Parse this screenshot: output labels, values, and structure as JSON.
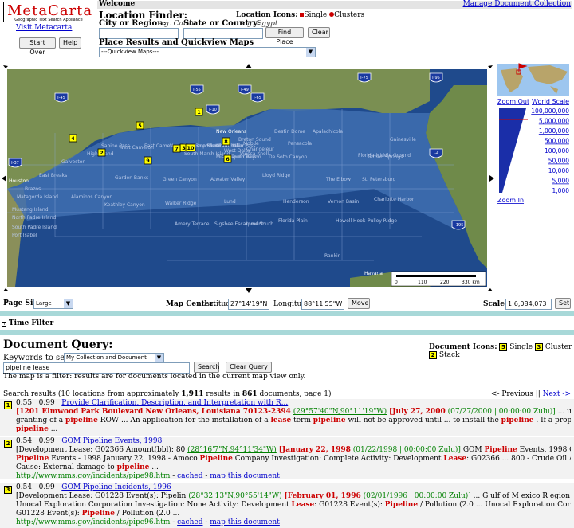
{
  "header": {
    "logo_text": "MetaCarta",
    "logo_sub": "Geographic Text Search Appliance",
    "visit_link": "Visit Metacarta",
    "welcome": "Welcome",
    "manage_link": "Manage Document Collection",
    "start_over": "Start Over",
    "help": "Help"
  },
  "location_finder": {
    "title": "Location Finder:",
    "city_label": "City or Region:",
    "city_hint": "e.g. Cairo",
    "state_label": "State or Country:",
    "state_hint": "e.g. Egypt",
    "find_button": "Find Place",
    "clear_button": "Clear",
    "icons_label": "Location Icons:",
    "icon_single": "Single",
    "icon_clusters": "Clusters"
  },
  "quickview": {
    "title": "Place Results and Quickview Maps",
    "select_value": "---Quickview Maps---"
  },
  "map": {
    "numbered_markers": [
      "1",
      "2",
      "3",
      "4",
      "5",
      "6",
      "7",
      "8",
      "9",
      "10"
    ],
    "state_labels": [
      "Houston",
      "New Orleans",
      "Havana"
    ],
    "highway_labels": [
      "I-55",
      "I-10",
      "I-65",
      "I-75",
      "I-95",
      "I-45",
      "I-37",
      "I-4",
      "I-195",
      "I-49"
    ],
    "zone_labels": [
      "East Breaks",
      "Alaminos Canyon",
      "Keathley Canyon",
      "Garden Banks",
      "Green Canyon",
      "Walker Ridge",
      "Atwater Valley",
      "Lloyd Ridge",
      "Mississippi Canyon",
      "De Soto Canyon",
      "Destin Dome",
      "Apalachicola",
      "The Elbow",
      "Vernon Basin",
      "Florida Middle Ground",
      "St. Petersburg",
      "Charlotte Harbor",
      "Howell Hook",
      "Pulley Ridge",
      "Rankin",
      "Lund",
      "Henderson",
      "Sigsbee Escarpment",
      "Amery Terrace",
      "Lund South",
      "Florida Plain",
      "Gainesville",
      "Tarpon Springs",
      "Pensacola",
      "Mobile",
      "Viosca Knoll",
      "Main Pass",
      "Breton Sound",
      "Chandeleur",
      "West Cameron",
      "East Cameron",
      "Vermilion",
      "South Marsh Island",
      "Eugene Island",
      "Ship Shoal",
      "South Timbalier",
      "Grand Isle",
      "West Delta",
      "South Pass",
      "Galveston",
      "High Island",
      "Sabine Pass",
      "Brazos",
      "Matagorda Island",
      "Mustang Island",
      "North Padre Island",
      "South Padre Island",
      "Port Isabel"
    ],
    "scale_labels": [
      "0",
      "110",
      "220",
      "330 km"
    ],
    "zoom_out": "Zoom Out",
    "world_scale": "World Scale",
    "scales": [
      "100,000,000",
      "5,000,000",
      "1,000,000",
      "500,000",
      "100,000",
      "50,000",
      "10,000",
      "5,000",
      "1,000"
    ],
    "zoom_in": "Zoom In"
  },
  "map_controls": {
    "page_size_label": "Page Size:",
    "page_size_value": "Large",
    "center_label": "Map Center:",
    "lat_label": "Latitude",
    "lat_value": "27°14'19\"N",
    "lon_label": "Longitude",
    "lon_value": "88°11'55\"W",
    "move_button": "Move",
    "scale_label": "Scale:",
    "scale_value": "1:6,084,073",
    "set_button": "Set"
  },
  "time_filter": "Time Filter",
  "query": {
    "title": "Document Query:",
    "keywords_label": "Keywords to search:",
    "collection_value": "My Collection and Document Collection",
    "search_value": "pipeline lease",
    "search_button": "Search",
    "clear_button": "Clear Query",
    "note": "The map is a filter: results are for documents located in the current map view only.",
    "doc_icons_label": "Document Icons:",
    "icon_single": "Single",
    "icon_cluster": "Cluster",
    "icon_stack": "Stack"
  },
  "results_summary": {
    "prefix": "Search results (10 locations from approximately ",
    "count": "1,911",
    "middle": " results in ",
    "docs": "861",
    "suffix": " documents, page 1)",
    "previous": "<- Previous",
    "sep": " || ",
    "next": "Next ->"
  },
  "results": [
    {
      "num": "1",
      "score1": "0.55",
      "score2": "0.99",
      "title": "Provide Clarification, Description, and Interpretation with R...",
      "line1_place": "[1201 Elmwood Park Boulevard New Orleans, Louisiana 70123-2394",
      "line1_coord": "(29°57'40\"N,90°11'19\"W)",
      "line1_date": "[July 27, 2000",
      "line1_date2": "(07/27/2000 | 00:00:00 Zulu)]",
      "line1_text": " ... installation of a lease term or ROW pipeline and the",
      "line2": "granting of a pipeline ROW ... An application for the installation of a lease term pipeline will not be approved until ... to install the pipeline . If a proposed lease term pipeline will cross an existing",
      "line3": "pipeline ..."
    },
    {
      "num": "2",
      "score1": "0.54",
      "score2": "0.99",
      "title": "GOM Pipeline Events, 1998",
      "line1_place": "[Development Lease: G02366 Amount(bbl): 80",
      "line1_coord": "(28°16'7\"N,94°11'34\"W)",
      "line1_date": "[January 22, 1998",
      "line1_date2": "(01/22/1998 | 00:00:00 Zulu)]",
      "line1_text": " GOM Pipeline Events, 1998 Content: Melinda Mayes Pagemaster : Marcia ...",
      "line2": "Pipeline Events - 1998 January 22, 1998 - Amoco Pipeline Company Investigation: Complete Activity: Development Lease: G02366 ... 800 - Crude Oil Area: High Island Operation: Pagemaster Pipeline Block: A474",
      "line3": "Cause: External damage to pipeline ...",
      "url": "http://www.mms.gov/incidents/pipe98.htm",
      "cached": "cached",
      "map_doc": "map this document"
    },
    {
      "num": "3",
      "score1": "0.54",
      "score2": "0.99",
      "title": "GOM Pipeline Incidents, 1996",
      "line1_place": "[Development Lease: G01228 Event(s): Pipelin",
      "line1_coord": "(28°32'13\"N,90°55'14\"W)",
      "line1_date": "[February 01, 1996",
      "line1_date2": "(02/01/1996 | 00:00:00 Zulu)]",
      "line1_text": " ... G ulf of M exico R egion Pipeline Incidents - 1996 February 01, 1996 -",
      "line2": "Unocal Exploration Corporation Investigation: None Activity: Development Lease: G01228 Event(s): Pipeline / Pollution (2.0 ... Unocal Exploration Corporation Investigation: None Activity: Development Lease:",
      "line3": "G01228 Event(s): Pipeline / Pollution (2.0 ...",
      "url": "http://www.mms.gov/incidents/pipe96.htm",
      "cached": "cached",
      "map_doc": "map this document"
    }
  ]
}
